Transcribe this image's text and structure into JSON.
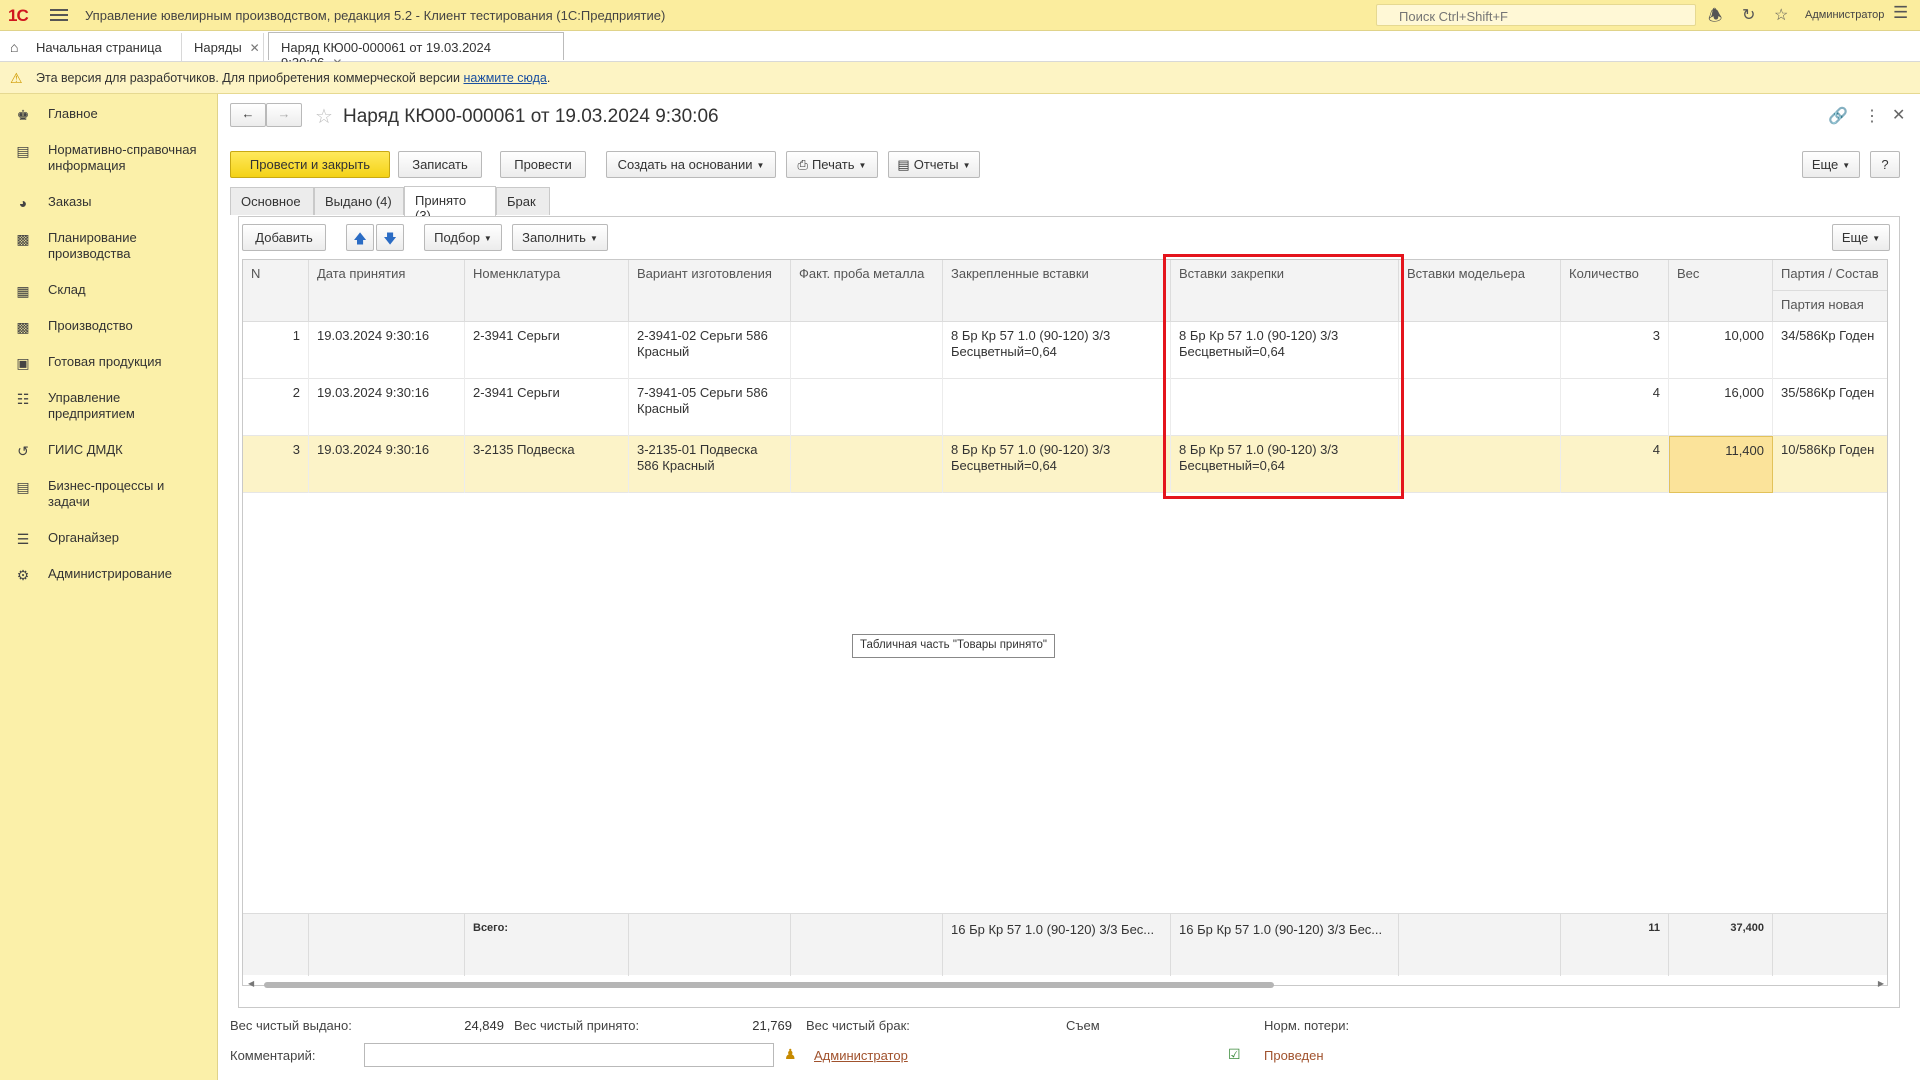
{
  "app": {
    "logo": "1С",
    "title": "Управление ювелирным производством, редакция 5.2  - Клиент тестирования (1С:Предприятие)",
    "search_placeholder": "Поиск Ctrl+Shift+F",
    "user": "Администратор"
  },
  "tabs": [
    {
      "label": "Начальная страница"
    },
    {
      "label": "Наряды"
    },
    {
      "label": "Наряд КЮ00-000061 от 19.03.2024 9:30:06"
    }
  ],
  "info": {
    "text": "Эта версия для разработчиков. Для приобретения коммерческой версии ",
    "link": "нажмите сюда",
    "tail": "."
  },
  "sidebar": {
    "items": [
      {
        "label": "Главное",
        "icon": "crown-icon"
      },
      {
        "label": "Нормативно-справочная информация",
        "icon": "book-icon"
      },
      {
        "label": "Заказы",
        "icon": "pie-icon"
      },
      {
        "label": "Планирование производства",
        "icon": "clipboard-icon"
      },
      {
        "label": "Склад",
        "icon": "grid-icon"
      },
      {
        "label": "Производство",
        "icon": "factory-icon"
      },
      {
        "label": "Готовая продукция",
        "icon": "bag-icon"
      },
      {
        "label": "Управление предприятием",
        "icon": "org-icon"
      },
      {
        "label": "ГИИС ДМДК",
        "icon": "sync-icon"
      },
      {
        "label": "Бизнес-процессы и задачи",
        "icon": "doc-icon"
      },
      {
        "label": "Органайзер",
        "icon": "sliders-icon"
      },
      {
        "label": "Администрирование",
        "icon": "gear-icon"
      }
    ]
  },
  "document": {
    "title": "Наряд КЮ00-000061 от 19.03.2024 9:30:06",
    "toolbar": {
      "post_close": "Провести и закрыть",
      "save": "Записать",
      "post": "Провести",
      "create_based": "Создать на основании",
      "print": "Печать",
      "reports": "Отчеты",
      "more": "Еще",
      "help": "?"
    },
    "form_tabs": [
      "Основное",
      "Выдано (4)",
      "Принято (3)",
      "Брак"
    ],
    "table_toolbar": {
      "add": "Добавить",
      "pick": "Подбор",
      "fill": "Заполнить",
      "more": "Еще"
    },
    "columns": [
      "N",
      "Дата принятия",
      "Номенклатура",
      "Вариант изготовления",
      "Факт. проба металла",
      "Закрепленные вставки",
      "Вставки закрепки",
      "Вставки модельера",
      "Количество",
      "Вес",
      "Партия / Состав",
      "Партия новая"
    ],
    "rows": [
      {
        "n": "1",
        "date": "19.03.2024 9:30:16",
        "nom": "2-3941 Серьги",
        "variant": "2-3941-02 Серьги 586 Красный",
        "probe": "",
        "fixed": "8 Бр Кр 57 1.0 (90-120) 3/3 Бесцветный=0,64",
        "setting": "8 Бр Кр 57 1.0 (90-120) 3/3 Бесцветный=0,64",
        "model": "",
        "qty": "3",
        "weight": "10,000",
        "batch": "34/586Кр Годен"
      },
      {
        "n": "2",
        "date": "19.03.2024 9:30:16",
        "nom": "2-3941 Серьги",
        "variant": "7-3941-05 Серьги 586 Красный",
        "probe": "",
        "fixed": "",
        "setting": "",
        "model": "",
        "qty": "4",
        "weight": "16,000",
        "batch": "35/586Кр Годен"
      },
      {
        "n": "3",
        "date": "19.03.2024 9:30:16",
        "nom": "3-2135 Подвеска",
        "variant": "3-2135-01 Подвеска 586 Красный",
        "probe": "",
        "fixed": "8 Бр Кр 57 1.0 (90-120) 3/3 Бесцветный=0,64",
        "setting": "8 Бр Кр 57 1.0 (90-120) 3/3 Бесцветный=0,64",
        "model": "",
        "qty": "4",
        "weight": "11,400",
        "batch": "10/586Кр Годен"
      }
    ],
    "totals": {
      "label": "Всего:",
      "fixed": "16 Бр Кр 57 1.0 (90-120) 3/3 Бес...",
      "setting": "16 Бр Кр 57 1.0 (90-120) 3/3 Бес...",
      "qty": "11",
      "weight": "37,400"
    },
    "tooltip": "Табличная часть \"Товары принято\"",
    "bottom": {
      "net_out_label": "Вес чистый выдано:",
      "net_out": "24,849",
      "net_in_label": "Вес чистый принято:",
      "net_in": "21,769",
      "net_defect_label": "Вес чистый брак:",
      "removal_label": "Съем",
      "loss_label": "Норм. потери:",
      "comment_label": "Комментарий:",
      "author": "Администратор",
      "status": "Проведен"
    }
  }
}
